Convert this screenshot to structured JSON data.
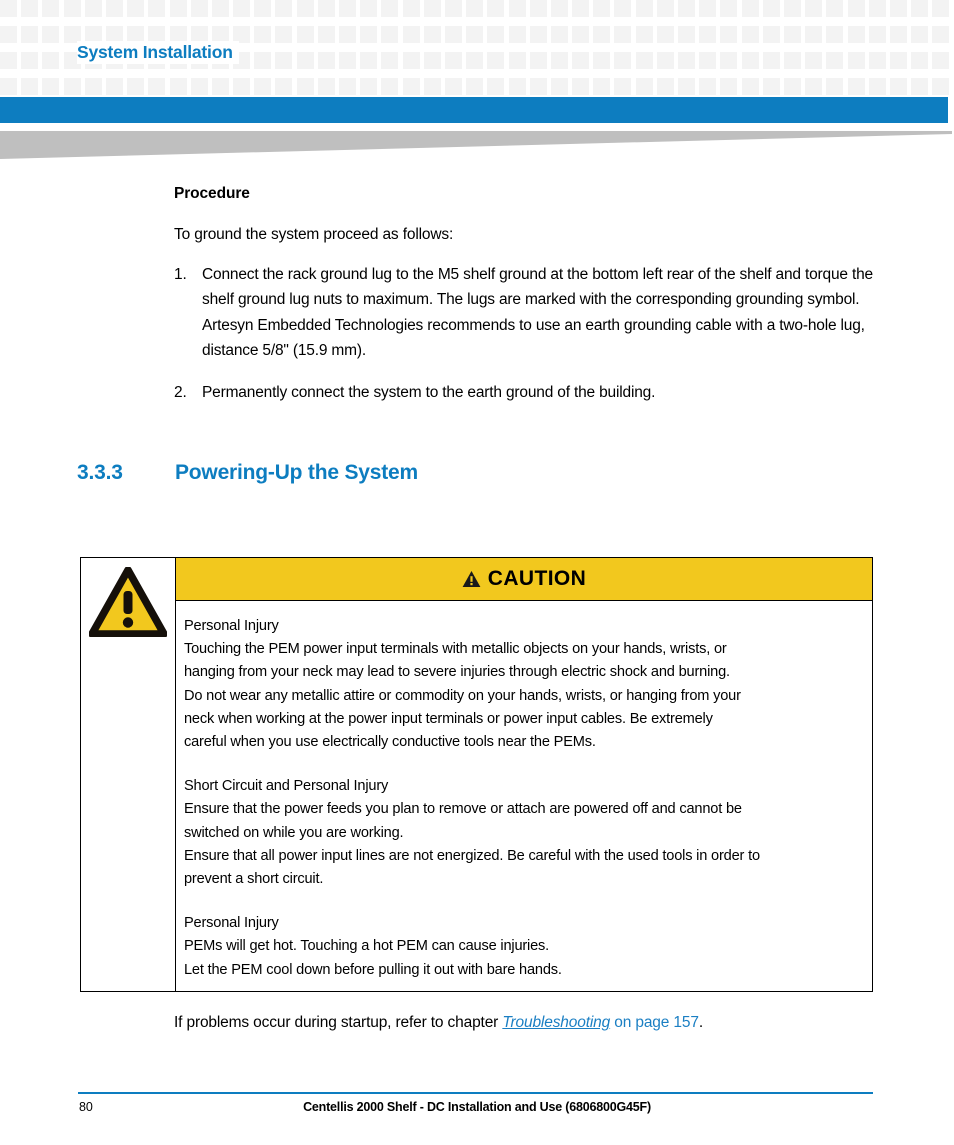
{
  "header": {
    "running_title": "System Installation",
    "accent_color": "#0d7dc0",
    "pattern_square_color": "#f3f3f3",
    "swoosh_color": "#bfbfbf"
  },
  "procedure": {
    "heading": "Procedure",
    "intro": "To ground the system proceed as follows:",
    "steps": [
      {
        "number": "1.",
        "text": "Connect the rack ground lug to the M5 shelf ground at the bottom left rear of the shelf and torque the shelf ground lug nuts to maximum. The lugs are marked with the corresponding grounding symbol. Artesyn Embedded Technologies recommends to use an earth grounding cable with a two-hole lug, distance 5/8\" (15.9 mm)."
      },
      {
        "number": "2.",
        "text": "Permanently connect the system to the earth ground of the building."
      }
    ]
  },
  "section": {
    "number": "3.3.3",
    "title": "Powering-Up the System",
    "color": "#0d7dc0"
  },
  "caution": {
    "banner_label": "CAUTION",
    "banner_color": "#f2c81e",
    "icon_name": "warning-triangle-icon",
    "blocks": [
      {
        "title": "Personal Injury",
        "lines": [
          "Touching the PEM power input terminals with metallic objects on your hands, wrists, or",
          "hanging from your neck may lead to severe injuries through electric shock and burning.",
          "Do not wear any metallic attire or commodity on your hands, wrists, or hanging from your",
          "neck when working at the power input terminals or power input cables. Be extremely",
          "careful when you use electrically conductive tools near the PEMs."
        ]
      },
      {
        "title": "Short Circuit and Personal Injury",
        "lines": [
          "Ensure that the power feeds you plan to remove or attach are powered off and cannot be",
          "switched on while you are working.",
          "Ensure that all power input lines are not energized. Be careful with the used tools in order to",
          "prevent a short circuit."
        ]
      },
      {
        "title": "Personal Injury",
        "lines": [
          "PEMs will get hot. Touching a hot PEM can cause injuries.",
          "Let the PEM cool down before pulling it out with bare hands."
        ]
      }
    ]
  },
  "after_note": {
    "lead": "If problems occur during startup, refer to chapter ",
    "xref_title": "Troubleshooting",
    "xref_page": " on page 157",
    "trailing": ".",
    "link_color": "#1b7fc3"
  },
  "footer": {
    "page_number": "80",
    "document_title": "Centellis 2000 Shelf - DC Installation and Use (6806800G45F)",
    "rule_color": "#0d7dc0"
  }
}
